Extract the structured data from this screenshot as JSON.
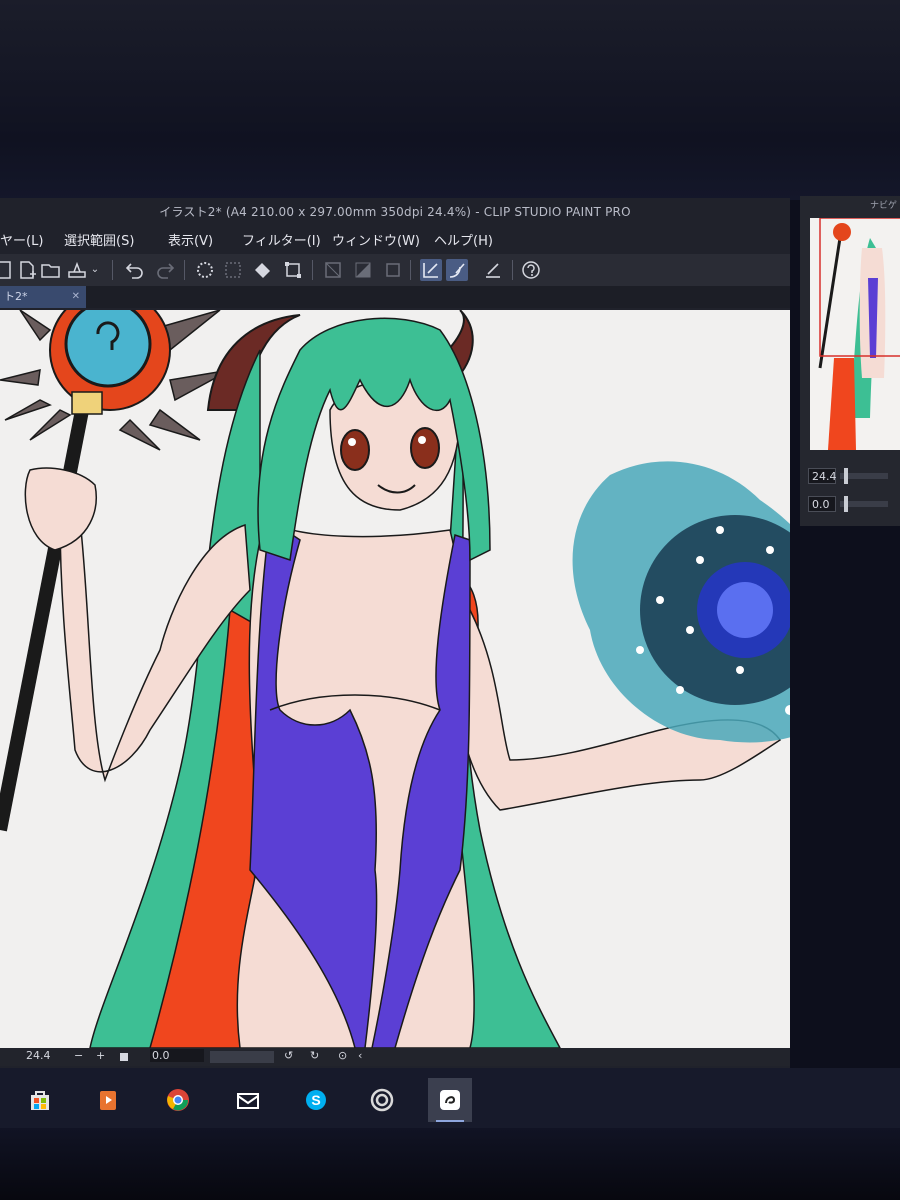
{
  "window": {
    "title": "イラスト2* (A4 210.00 x 297.00mm 350dpi 24.4%) - CLIP STUDIO PAINT PRO"
  },
  "menubar": {
    "items": [
      {
        "label": "ヤー(L)"
      },
      {
        "label": "選択範囲(S)"
      },
      {
        "label": "表示(V)"
      },
      {
        "label": "フィルター(I)"
      },
      {
        "label": "ウィンドウ(W)"
      },
      {
        "label": "ヘルプ(H)"
      }
    ]
  },
  "toolbar": {
    "icons": [
      "new-file-icon",
      "open-folder-icon",
      "save-icon",
      "dropdown-icon",
      "undo-icon",
      "redo-icon",
      "clear-selection-icon",
      "deselect-icon",
      "fill-icon",
      "transform-icon",
      "show-selection-icon",
      "invert-selection-icon",
      "clear-icon",
      "snap-ruler-icon",
      "snap-special-ruler-icon",
      "snap-grid-icon",
      "help-icon"
    ]
  },
  "tab": {
    "label": "ト2*"
  },
  "statusbar": {
    "zoom": "24.4",
    "minus": "−",
    "plus": "+",
    "angle": "0.0"
  },
  "navigator": {
    "title": "ナビゲ",
    "zoom_value": "24.4",
    "rotate_value": "0.0"
  },
  "taskbar": {
    "apps": [
      {
        "name": "store-app-icon",
        "active": false
      },
      {
        "name": "media-player-icon",
        "active": false
      },
      {
        "name": "chrome-icon",
        "active": false
      },
      {
        "name": "mail-icon",
        "active": false
      },
      {
        "name": "skype-icon",
        "active": false
      },
      {
        "name": "clip-studio-icon",
        "active": false
      },
      {
        "name": "clip-studio-paint-icon",
        "active": true
      }
    ]
  },
  "colors": {
    "hair": "#3dbf94",
    "swimsuit": "#5b3fd4",
    "cape": "#f0461e",
    "horns": "#6b2a25",
    "canvas": "#f1f0ef",
    "accent": "#4a5c84"
  }
}
